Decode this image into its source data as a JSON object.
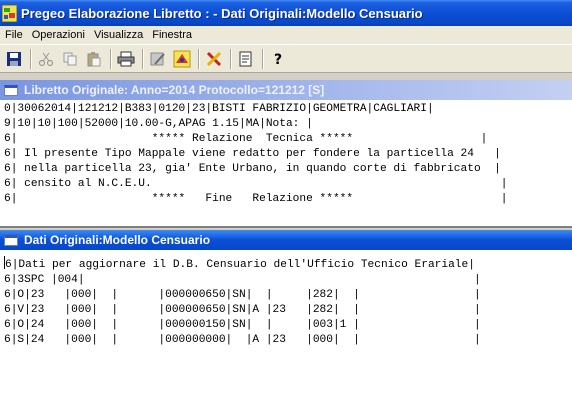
{
  "window": {
    "title": "Pregeo Elaborazione Libretto : -  Dati Originali:Modello Censuario"
  },
  "menu": {
    "items": [
      "File",
      "Operazioni",
      "Visualizza",
      "Finestra"
    ]
  },
  "toolbar": {
    "buttons": [
      "save-icon",
      "cut-icon",
      "copy-icon",
      "paste-icon",
      "print-icon",
      "edit-icon",
      "run-icon",
      "tools-icon",
      "notes-icon",
      "help-icon"
    ]
  },
  "libretto": {
    "title": "Libretto Originale: Anno=2014 Protocollo=121212 [S]",
    "lines": [
      "0|30062014|121212|B383|0120|23|BISTI FABRIZIO|GEOMETRA|CAGLIARI|",
      "9|10|10|100|52000|10.00-G,APAG 1.15|MA|Nota: |",
      "6|                    ***** Relazione  Tecnica *****                   |",
      "6| Il presente Tipo Mappale viene redatto per fondere la particella 24   |",
      "6| nella particella 23, gia' Ente Urbano, in quando corte di fabbricato  |",
      "6| censito al N.C.E.U.                                                    |",
      "6|                    *****   Fine   Relazione *****                      |"
    ]
  },
  "censuario": {
    "title": "Dati Originali:Modello Censuario",
    "lines": [
      "6|Dati per aggiornare il D.B. Censuario dell'Ufficio Tecnico Erariale|",
      "6|3SPC |004|                                                          |",
      "6|O|23   |000|  |      |000000650|SN|  |     |282|  |                 |",
      "6|V|23   |000|  |      |000000650|SN|A |23   |282|  |                 |",
      "6|O|24   |000|  |      |000000150|SN|  |     |003|1 |                 |",
      "6|S|24   |000|  |      |000000000|  |A |23   |000|  |                 |"
    ]
  },
  "colors": {
    "title_active": "#0a4fd6",
    "title_inactive": "#a6b8ec",
    "window_bg": "#ece9d8"
  }
}
